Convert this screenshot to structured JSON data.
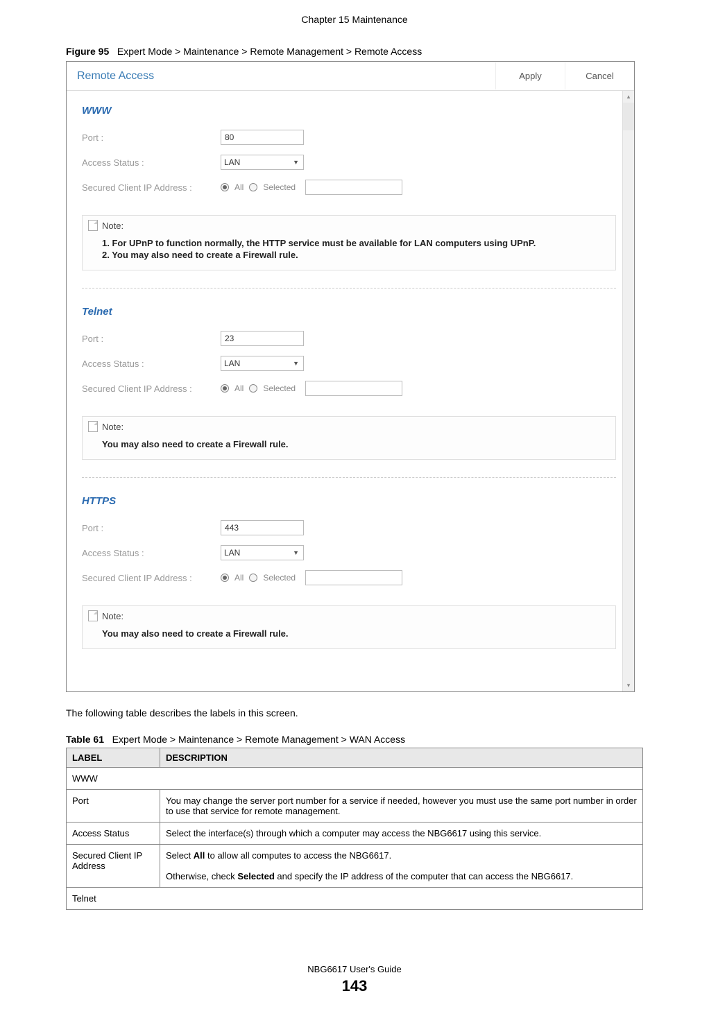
{
  "header": {
    "chapter": "Chapter 15 Maintenance"
  },
  "figure": {
    "label": "Figure 95",
    "caption": "Expert Mode > Maintenance > Remote Management > Remote Access",
    "panel_title": "Remote Access",
    "apply_btn": "Apply",
    "cancel_btn": "Cancel"
  },
  "sections": {
    "www": {
      "title": "WWW",
      "port_label": "Port :",
      "port_value": "80",
      "access_label": "Access Status :",
      "access_value": "LAN",
      "secured_label": "Secured Client IP Address :",
      "radio_all": "All",
      "radio_selected": "Selected",
      "note_header": "Note:",
      "note1": "1. For UPnP to function normally, the HTTP service must be available for LAN computers using UPnP.",
      "note2": "2. You may also need to create a Firewall rule."
    },
    "telnet": {
      "title": "Telnet",
      "port_label": "Port :",
      "port_value": "23",
      "access_label": "Access Status :",
      "access_value": "LAN",
      "secured_label": "Secured Client IP Address :",
      "radio_all": "All",
      "radio_selected": "Selected",
      "note_header": "Note:",
      "note1": "You may also need to create a Firewall rule."
    },
    "https": {
      "title": "HTTPS",
      "port_label": "Port :",
      "port_value": "443",
      "access_label": "Access Status :",
      "access_value": "LAN",
      "secured_label": "Secured Client IP Address :",
      "radio_all": "All",
      "radio_selected": "Selected",
      "note_header": "Note:",
      "note1": "You may also need to create a Firewall rule."
    }
  },
  "postfigure": "The following table describes the labels in this screen.",
  "table": {
    "caption_label": "Table 61",
    "caption_text": "Expert Mode > Maintenance > Remote Management > WAN Access",
    "h_label": "LABEL",
    "h_desc": "DESCRIPTION",
    "r_www": "WWW",
    "r_port_l": "Port",
    "r_port_d": "You may change the server port number for a service if needed, however you must use the same port number in order to use that service for remote management.",
    "r_access_l": "Access Status",
    "r_access_d": "Select the interface(s) through which a computer may access the NBG6617 using this service.",
    "r_sec_l": "Secured Client IP Address",
    "r_sec_d1": "Select ",
    "r_sec_d1b": "All",
    "r_sec_d1c": " to allow all computes to access the NBG6617.",
    "r_sec_d2a": "Otherwise, check ",
    "r_sec_d2b": "Selected",
    "r_sec_d2c": " and specify the IP address of the computer that can access the NBG6617.",
    "r_telnet": "Telnet"
  },
  "footer": {
    "guide": "NBG6617 User's Guide",
    "page": "143"
  }
}
